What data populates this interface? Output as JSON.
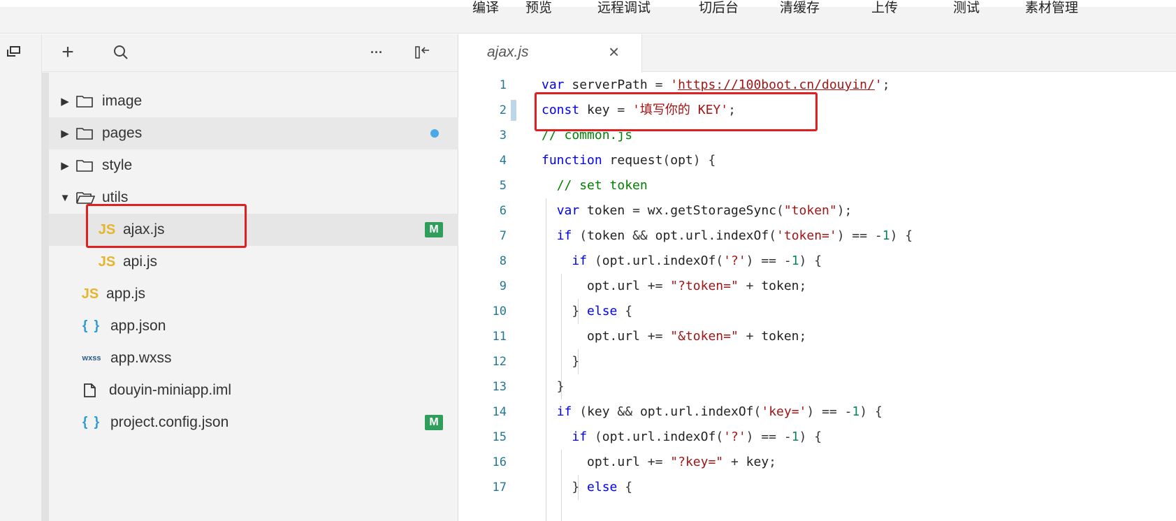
{
  "toolbar": {
    "items": [
      "编译",
      "预览",
      "远程调试",
      "切后台",
      "清缓存",
      "上传",
      "测试",
      "素材管理"
    ]
  },
  "explorer": {
    "actions": {
      "add": "+",
      "more": "···"
    },
    "tree": [
      {
        "label": "image",
        "type": "folder",
        "expanded": false
      },
      {
        "label": "pages",
        "type": "folder",
        "expanded": false,
        "badge": "dot"
      },
      {
        "label": "style",
        "type": "folder",
        "expanded": false
      },
      {
        "label": "utils",
        "type": "folder",
        "expanded": true
      },
      {
        "label": "ajax.js",
        "type": "js",
        "badge": "M",
        "selected": true
      },
      {
        "label": "api.js",
        "type": "js"
      },
      {
        "label": "app.js",
        "type": "js"
      },
      {
        "label": "app.json",
        "type": "json"
      },
      {
        "label": "app.wxss",
        "type": "wxss"
      },
      {
        "label": "douyin-miniapp.iml",
        "type": "file"
      },
      {
        "label": "project.config.json",
        "type": "json",
        "badge": "M"
      }
    ],
    "icon_labels": {
      "js": "JS",
      "json": "{ }",
      "wxss": "wxss"
    }
  },
  "editor": {
    "tab": {
      "title": "ajax.js",
      "close": "×"
    },
    "lines": [
      {
        "n": "1",
        "text": "var serverPath = 'https://100boot.cn/douyin/';"
      },
      {
        "n": "2",
        "text": "const key = '填写你的 KEY';"
      },
      {
        "n": "3",
        "text": "// common.js"
      },
      {
        "n": "4",
        "text": "function request(opt) {"
      },
      {
        "n": "5",
        "text": "  // set token"
      },
      {
        "n": "6",
        "text": "  var token = wx.getStorageSync(\"token\");"
      },
      {
        "n": "7",
        "text": "  if (token && opt.url.indexOf('token=') == -1) {"
      },
      {
        "n": "8",
        "text": "    if (opt.url.indexOf('?') == -1) {"
      },
      {
        "n": "9",
        "text": "      opt.url += \"?token=\" + token;"
      },
      {
        "n": "10",
        "text": "    } else {"
      },
      {
        "n": "11",
        "text": "      opt.url += \"&token=\" + token;"
      },
      {
        "n": "12",
        "text": "    }"
      },
      {
        "n": "13",
        "text": "  }"
      },
      {
        "n": "14",
        "text": "  if (key && opt.url.indexOf('key=') == -1) {"
      },
      {
        "n": "15",
        "text": "    if (opt.url.indexOf('?') == -1) {"
      },
      {
        "n": "16",
        "text": "      opt.url += \"?key=\" + key;"
      },
      {
        "n": "17",
        "text": "    } else {"
      }
    ]
  },
  "colors": {
    "highlight_box": "#e02020",
    "modified_badge": "#2f9e5a",
    "unsaved_dot": "#4aa8e8",
    "js_icon": "#e7b52c",
    "json_icon": "#2c9ad8"
  }
}
